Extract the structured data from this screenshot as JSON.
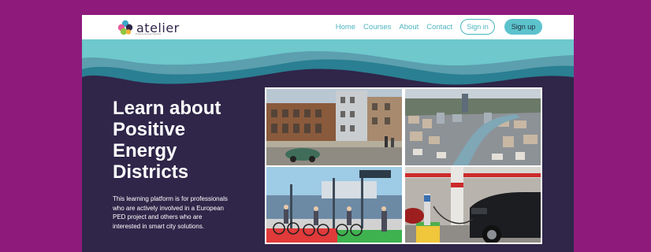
{
  "brand": {
    "name": "atelier",
    "tagline": "Positive Energy Districts",
    "icon": "atelier-logo-icon",
    "colors": {
      "accent": "#4cb5c1",
      "dark": "#2f2649",
      "background": "#8e1b7c"
    }
  },
  "nav": {
    "links": [
      "Home",
      "Courses",
      "About",
      "Contact"
    ],
    "sign_in": "Sign in",
    "sign_up": "Sign up"
  },
  "hero": {
    "title_lines": [
      "Learn about",
      "Positive",
      "Energy",
      "Districts"
    ],
    "description_lines": [
      "This learning platform is for professionals",
      "who are actively involved in a European",
      "PED project and others who are",
      "interested in smart city solutions."
    ]
  },
  "images": [
    {
      "name": "city-street-photo"
    },
    {
      "name": "river-city-aerial-photo"
    },
    {
      "name": "bike-station-photo"
    },
    {
      "name": "ev-charging-photo"
    }
  ]
}
